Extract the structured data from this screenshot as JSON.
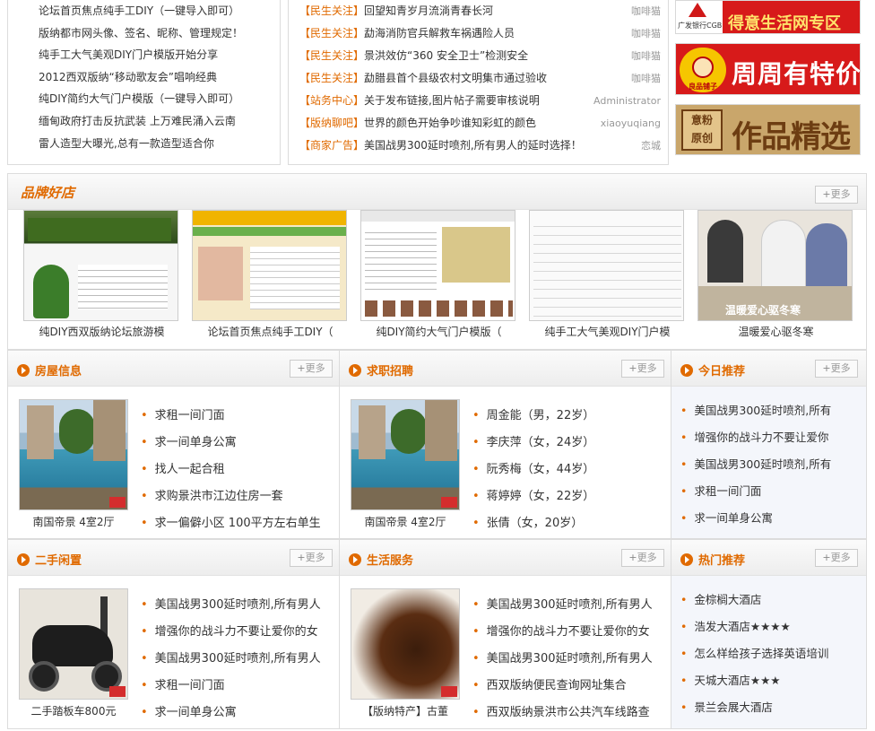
{
  "top_left_links": [
    "论坛首页焦点纯手工DIY（一键导入即可）",
    "版纳都市网头像、签名、昵称、管理规定！",
    "纯手工大气美观DIY门户模版开始分享",
    "2012西双版纳“移动歌友会”唱响经典",
    "纯DIY简约大气门户模版（一键导入即可）",
    "缅甸政府打击反抗武装 上万难民涌入云南",
    "雷人造型大曝光,总有一款造型适合你"
  ],
  "top_news": [
    {
      "cat": "【民生关注】",
      "title": "回望知青岁月流淌青春长河",
      "author": "咖啡猫"
    },
    {
      "cat": "【民生关注】",
      "title": "勐海消防官兵解救车祸遇险人员",
      "author": "咖啡猫"
    },
    {
      "cat": "【民生关注】",
      "title": "景洪效仿“360 安全卫士”检测安全",
      "author": "咖啡猫"
    },
    {
      "cat": "【民生关注】",
      "title": "勐腊县首个县级农村文明集市通过验收",
      "author": "咖啡猫"
    },
    {
      "cat": "【站务中心】",
      "title": "关于发布链接,图片帖子需要审核说明",
      "author": "Administrator"
    },
    {
      "cat": "【版纳聊吧】",
      "title": "世界的颜色开始争吵谁知彩虹的颜色",
      "author": "xiaoyuqiang"
    },
    {
      "cat": "【商家广告】",
      "title": "美国战男300延时喷剂,所有男人的延时选择！",
      "author": "恋城"
    }
  ],
  "ads": {
    "ad1_logo": "广发银行CGB",
    "ad1_text": "得意生活网专区",
    "ad2_logo": "良品铺子",
    "ad2_text": "周周有特价",
    "ad3_seal": [
      "意粉",
      "原创"
    ],
    "ad3_text": "作品精选"
  },
  "brand": {
    "title": "品牌好店",
    "more": "更多",
    "shops": [
      "纯DIY西双版纳论坛旅游模",
      "论坛首页焦点纯手工DIY（",
      "纯DIY简约大气门户模版（",
      "纯手工大气美观DIY门户模",
      "温暖爱心驱冬寒"
    ],
    "shop5_watermark": "温暖爱心驱冬寒"
  },
  "housing": {
    "title": "房屋信息",
    "more": "更多",
    "photo_caption": "南国帝景 4室2厅",
    "items": [
      "求租一间门面",
      "求一间单身公寓",
      "找人一起合租",
      "求购景洪市江边住房一套",
      "求一偏僻小区 100平方左右单生"
    ]
  },
  "jobs": {
    "title": "求职招聘",
    "more": "更多",
    "photo_caption": "南国帝景 4室2厅",
    "items": [
      "周金能（男，22岁）",
      "李庆萍（女，24岁）",
      "阮秀梅（女，44岁）",
      "蒋婷婷（女，22岁）",
      "张倩（女，20岁）"
    ]
  },
  "today": {
    "title": "今日推荐",
    "more": "更多",
    "items": [
      "美国战男300延时喷剂,所有",
      "增强你的战斗力不要让爱你",
      "美国战男300延时喷剂,所有",
      "求租一间门面",
      "求一间单身公寓"
    ]
  },
  "secondhand": {
    "title": "二手闲置",
    "more": "更多",
    "photo_caption": "二手踏板车800元",
    "items": [
      "美国战男300延时喷剂,所有男人",
      "增强你的战斗力不要让爱你的女",
      "美国战男300延时喷剂,所有男人",
      "求租一间门面",
      "求一间单身公寓"
    ]
  },
  "life": {
    "title": "生活服务",
    "more": "更多",
    "photo_caption": "【版纳特产】古董",
    "items": [
      "美国战男300延时喷剂,所有男人",
      "增强你的战斗力不要让爱你的女",
      "美国战男300延时喷剂,所有男人",
      "西双版纳便民查询网址集合",
      "西双版纳景洪市公共汽车线路查"
    ]
  },
  "hot": {
    "title": "热门推荐",
    "more": "更多",
    "items": [
      "金棕榈大酒店",
      "浩发大酒店★★★★",
      "怎么样给孩子选择英语培训",
      "天城大酒店★★★",
      "景兰会展大酒店"
    ]
  }
}
